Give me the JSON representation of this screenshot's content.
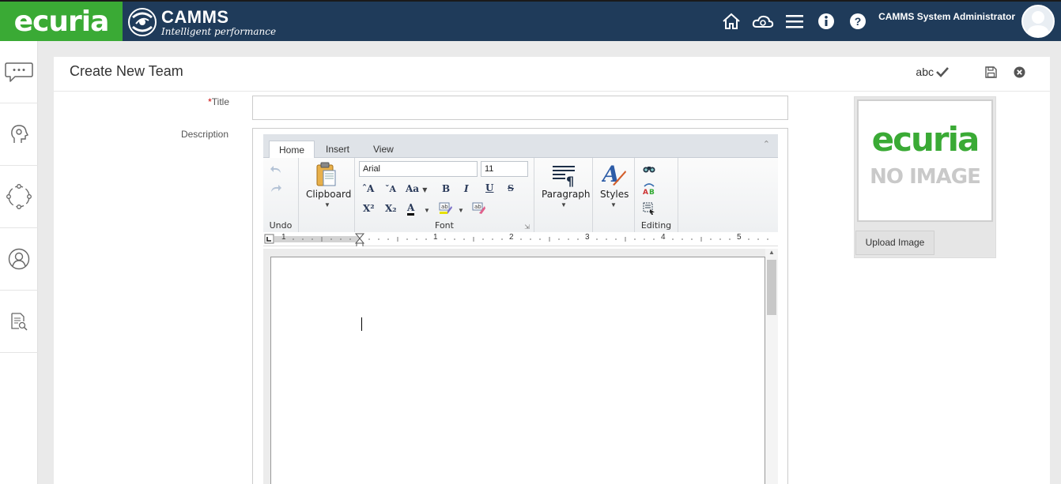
{
  "header": {
    "brand_left": "ecuria",
    "brand_main": "CAMMS",
    "brand_tagline": "Intelligent performance",
    "user_name": "CAMMS System Administrator"
  },
  "page": {
    "title": "Create New  Team",
    "spell_label": "abc"
  },
  "form": {
    "title_required_mark": "*",
    "title_label": "Title",
    "title_value": "",
    "description_label": "Description"
  },
  "editor": {
    "tabs": [
      "Home",
      "Insert",
      "View"
    ],
    "active_tab": "Home",
    "groups": {
      "undo": "Undo",
      "font": "Font",
      "editing": "Editing"
    },
    "clipboard_label": "Clipboard",
    "paragraph_label": "Paragraph",
    "styles_label": "Styles",
    "font_name": "Arial",
    "font_size": "11",
    "ruler_marks": [
      "1",
      "1",
      "2",
      "3",
      "4",
      "5"
    ]
  },
  "image": {
    "brand": "ecuria",
    "no_image_text": "NO IMAGE",
    "upload_label": "Upload Image"
  },
  "colors": {
    "header_bg": "#1f3b5a",
    "brand_green": "#3aaa35"
  }
}
